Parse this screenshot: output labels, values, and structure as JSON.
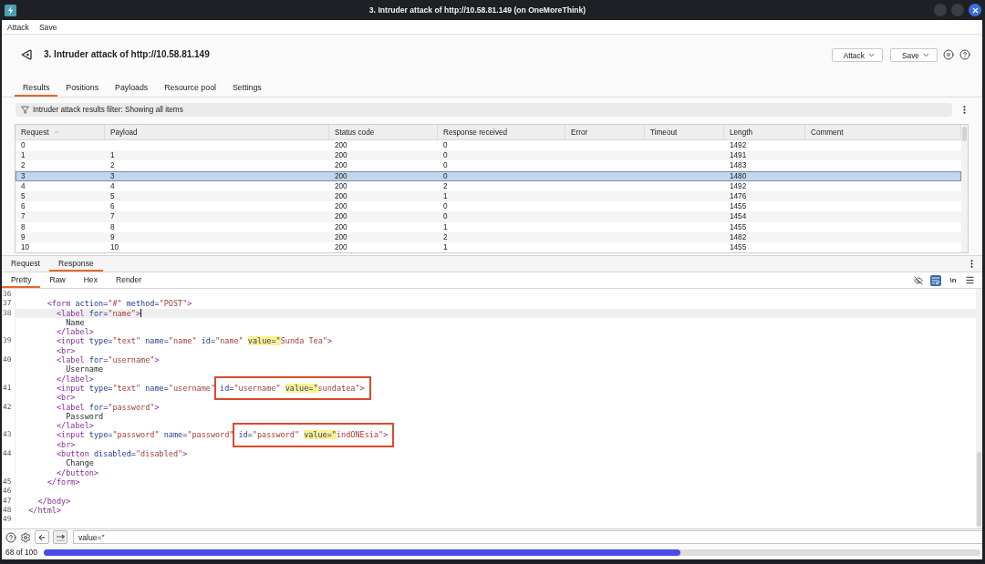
{
  "window": {
    "title": "3. Intruder attack of http://10.58.81.149 (on OneMoreThink)"
  },
  "menu": [
    "Attack",
    "Save"
  ],
  "header": {
    "title": "3. Intruder attack of http://10.58.81.149",
    "buttons": [
      "Attack",
      "Save"
    ]
  },
  "tabs": [
    {
      "label": "Results",
      "selected": true
    },
    {
      "label": "Positions",
      "selected": false
    },
    {
      "label": "Payloads",
      "selected": false
    },
    {
      "label": "Resource pool",
      "selected": false
    },
    {
      "label": "Settings",
      "selected": false
    }
  ],
  "filter": {
    "text": "Intruder attack results filter: Showing all items"
  },
  "table": {
    "columns": [
      {
        "label": "Request",
        "sorted": true
      },
      {
        "label": "Payload",
        "sorted": false
      },
      {
        "label": "Status code",
        "sorted": false
      },
      {
        "label": "Response received",
        "sorted": false
      },
      {
        "label": "Error",
        "sorted": false
      },
      {
        "label": "Timeout",
        "sorted": false
      },
      {
        "label": "Length",
        "sorted": false
      },
      {
        "label": "Comment",
        "sorted": false
      }
    ],
    "rows": [
      {
        "request": "0",
        "status_code": "200",
        "response_received": "0",
        "length": "1492",
        "selected": false
      },
      {
        "request": "1",
        "payload": "1",
        "status_code": "200",
        "response_received": "0",
        "length": "1491",
        "selected": false
      },
      {
        "request": "2",
        "payload": "2",
        "status_code": "200",
        "response_received": "0",
        "length": "1483",
        "selected": false
      },
      {
        "request": "3",
        "payload": "3",
        "status_code": "200",
        "response_received": "0",
        "length": "1480",
        "selected": true
      },
      {
        "request": "4",
        "payload": "4",
        "status_code": "200",
        "response_received": "2",
        "length": "1492",
        "selected": false
      },
      {
        "request": "5",
        "payload": "5",
        "status_code": "200",
        "response_received": "1",
        "length": "1476",
        "selected": false
      },
      {
        "request": "6",
        "payload": "6",
        "status_code": "200",
        "response_received": "0",
        "length": "1455",
        "selected": false
      },
      {
        "request": "7",
        "payload": "7",
        "status_code": "200",
        "response_received": "0",
        "length": "1454",
        "selected": false
      },
      {
        "request": "8",
        "payload": "8",
        "status_code": "200",
        "response_received": "1",
        "length": "1455",
        "selected": false
      },
      {
        "request": "9",
        "payload": "9",
        "status_code": "200",
        "response_received": "2",
        "length": "1482",
        "selected": false
      },
      {
        "request": "10",
        "payload": "10",
        "status_code": "200",
        "response_received": "1",
        "length": "1455",
        "selected": false
      }
    ]
  },
  "message_tabs": [
    {
      "label": "Request",
      "selected": false
    },
    {
      "label": "Response",
      "selected": true
    }
  ],
  "view_tabs": [
    {
      "label": "Pretty",
      "selected": true
    },
    {
      "label": "Raw",
      "selected": false
    },
    {
      "label": "Hex",
      "selected": false
    },
    {
      "label": "Render",
      "selected": false
    }
  ],
  "view_tools": [
    {
      "kind": "hide",
      "on": false
    },
    {
      "kind": "wrap",
      "on": true
    },
    {
      "kind": "newline",
      "label": "\\n",
      "on": false
    }
  ],
  "code_lines": [
    {
      "number": "36",
      "current": false
    },
    {
      "number": "37",
      "current": false,
      "tokens": [
        {
          "kind": "tag",
          "text": "      <form"
        },
        {
          "kind": "attr",
          "text": " action="
        },
        {
          "kind": "value",
          "text": "\"#\""
        },
        {
          "kind": "attr",
          "text": " method="
        },
        {
          "kind": "value",
          "text": "\"POST\""
        },
        {
          "kind": "tag",
          "text": ">"
        }
      ]
    },
    {
      "number": "38",
      "current": true,
      "tokens": [
        {
          "kind": "tag",
          "text": "        <label"
        },
        {
          "kind": "attr",
          "text": " for="
        },
        {
          "kind": "value",
          "text": "\"name\""
        },
        {
          "kind": "tag",
          "text": ">"
        }
      ]
    },
    {
      "current": false,
      "tokens": [
        {
          "kind": "text",
          "text": "          Name"
        }
      ]
    },
    {
      "current": false,
      "tokens": [
        {
          "kind": "tag",
          "text": "        </label>"
        }
      ]
    },
    {
      "number": "39",
      "current": false,
      "tokens": [
        {
          "kind": "tag",
          "text": "        <input"
        },
        {
          "kind": "attr",
          "text": " type="
        },
        {
          "kind": "value",
          "text": "\"text\""
        },
        {
          "kind": "attr",
          "text": " name="
        },
        {
          "kind": "value",
          "text": "\"name\""
        },
        {
          "kind": "attr",
          "text": " id="
        },
        {
          "kind": "value",
          "text": "\"name\" "
        },
        {
          "kind": "match",
          "text": "value=\""
        },
        {
          "kind": "value",
          "text": "Sunda Tea\""
        },
        {
          "kind": "tag",
          "text": ">"
        }
      ]
    },
    {
      "current": false,
      "tokens": [
        {
          "kind": "tag",
          "text": "        <br>"
        }
      ]
    },
    {
      "number": "40",
      "current": false,
      "tokens": [
        {
          "kind": "tag",
          "text": "        <label"
        },
        {
          "kind": "attr",
          "text": " for="
        },
        {
          "kind": "value",
          "text": "\"username\""
        },
        {
          "kind": "tag",
          "text": ">"
        }
      ]
    },
    {
      "current": false,
      "tokens": [
        {
          "kind": "text",
          "text": "          Username"
        }
      ]
    },
    {
      "current": false,
      "tokens": [
        {
          "kind": "tag",
          "text": "        </label>"
        }
      ]
    },
    {
      "number": "41",
      "current": false,
      "tokens": [
        {
          "kind": "tag",
          "text": "        <input"
        },
        {
          "kind": "attr",
          "text": " type="
        },
        {
          "kind": "value",
          "text": "\"text\""
        },
        {
          "kind": "attr",
          "text": " name="
        },
        {
          "kind": "value",
          "text": "\"username\""
        }
      ],
      "boxed_tokens": [
        {
          "kind": "attr",
          "text": "id="
        },
        {
          "kind": "value",
          "text": "\"username\" "
        },
        {
          "kind": "match",
          "text": "value=\""
        },
        {
          "kind": "value",
          "text": "sundatea\""
        },
        {
          "kind": "tag",
          "text": ">"
        }
      ]
    },
    {
      "current": false,
      "tokens": [
        {
          "kind": "tag",
          "text": "        <br>"
        }
      ]
    },
    {
      "number": "42",
      "current": false,
      "tokens": [
        {
          "kind": "tag",
          "text": "        <label"
        },
        {
          "kind": "attr",
          "text": " for="
        },
        {
          "kind": "value",
          "text": "\"password\""
        },
        {
          "kind": "tag",
          "text": ">"
        }
      ]
    },
    {
      "current": false,
      "tokens": [
        {
          "kind": "text",
          "text": "          Password"
        }
      ]
    },
    {
      "current": false,
      "tokens": [
        {
          "kind": "tag",
          "text": "        </label>"
        }
      ]
    },
    {
      "number": "43",
      "current": false,
      "tokens": [
        {
          "kind": "tag",
          "text": "        <input"
        },
        {
          "kind": "attr",
          "text": " type="
        },
        {
          "kind": "value",
          "text": "\"password\""
        },
        {
          "kind": "attr",
          "text": " name="
        },
        {
          "kind": "value",
          "text": "\"password\""
        }
      ],
      "boxed_tokens": [
        {
          "kind": "attr",
          "text": "id="
        },
        {
          "kind": "value",
          "text": "\"password\" "
        },
        {
          "kind": "match",
          "text": "value=\""
        },
        {
          "kind": "value",
          "text": "indONEsia\""
        },
        {
          "kind": "tag",
          "text": ">"
        }
      ]
    },
    {
      "current": false,
      "tokens": [
        {
          "kind": "tag",
          "text": "        <br>"
        }
      ]
    },
    {
      "number": "44",
      "current": false,
      "tokens": [
        {
          "kind": "tag",
          "text": "        <button"
        },
        {
          "kind": "attr",
          "text": " disabled="
        },
        {
          "kind": "value",
          "text": "\"disabled\""
        },
        {
          "kind": "tag",
          "text": ">"
        }
      ]
    },
    {
      "current": false,
      "tokens": [
        {
          "kind": "text",
          "text": "          Change"
        }
      ]
    },
    {
      "current": false,
      "tokens": [
        {
          "kind": "tag",
          "text": "        </button>"
        }
      ]
    },
    {
      "number": "45",
      "current": false,
      "tokens": [
        {
          "kind": "tag",
          "text": "      </form>"
        }
      ]
    },
    {
      "number": "46",
      "current": false
    },
    {
      "number": "47",
      "current": false,
      "tokens": [
        {
          "kind": "tag",
          "text": "    </body>"
        }
      ]
    },
    {
      "number": "48",
      "current": false,
      "tokens": [
        {
          "kind": "tag",
          "text": "  </html>"
        }
      ]
    },
    {
      "number": "49",
      "current": false
    }
  ],
  "search": {
    "value": "value=\""
  },
  "progress": {
    "text": "68 of 100",
    "level": 0.68
  }
}
